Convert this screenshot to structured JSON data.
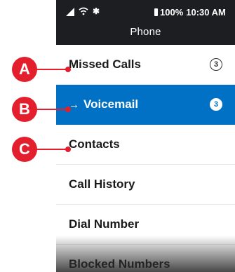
{
  "status": {
    "battery": "100%",
    "time": "10:30 AM",
    "signal_icon": "signal-icon",
    "wifi_icon": "wifi-icon",
    "bluetooth_icon": "bluetooth-icon"
  },
  "header": {
    "title": "Phone"
  },
  "menu": {
    "items": [
      {
        "label": "Missed Calls",
        "badge": "3",
        "active": false
      },
      {
        "label": "Voicemail",
        "badge": "3",
        "active": true
      },
      {
        "label": "Contacts"
      },
      {
        "label": "Call History"
      },
      {
        "label": "Dial Number"
      },
      {
        "label": "Blocked Numbers"
      }
    ]
  },
  "callouts": [
    "A",
    "B",
    "C"
  ],
  "colors": {
    "accent": "#0071c5",
    "callout": "#e41f2d",
    "statusbar": "#1c1e21"
  }
}
